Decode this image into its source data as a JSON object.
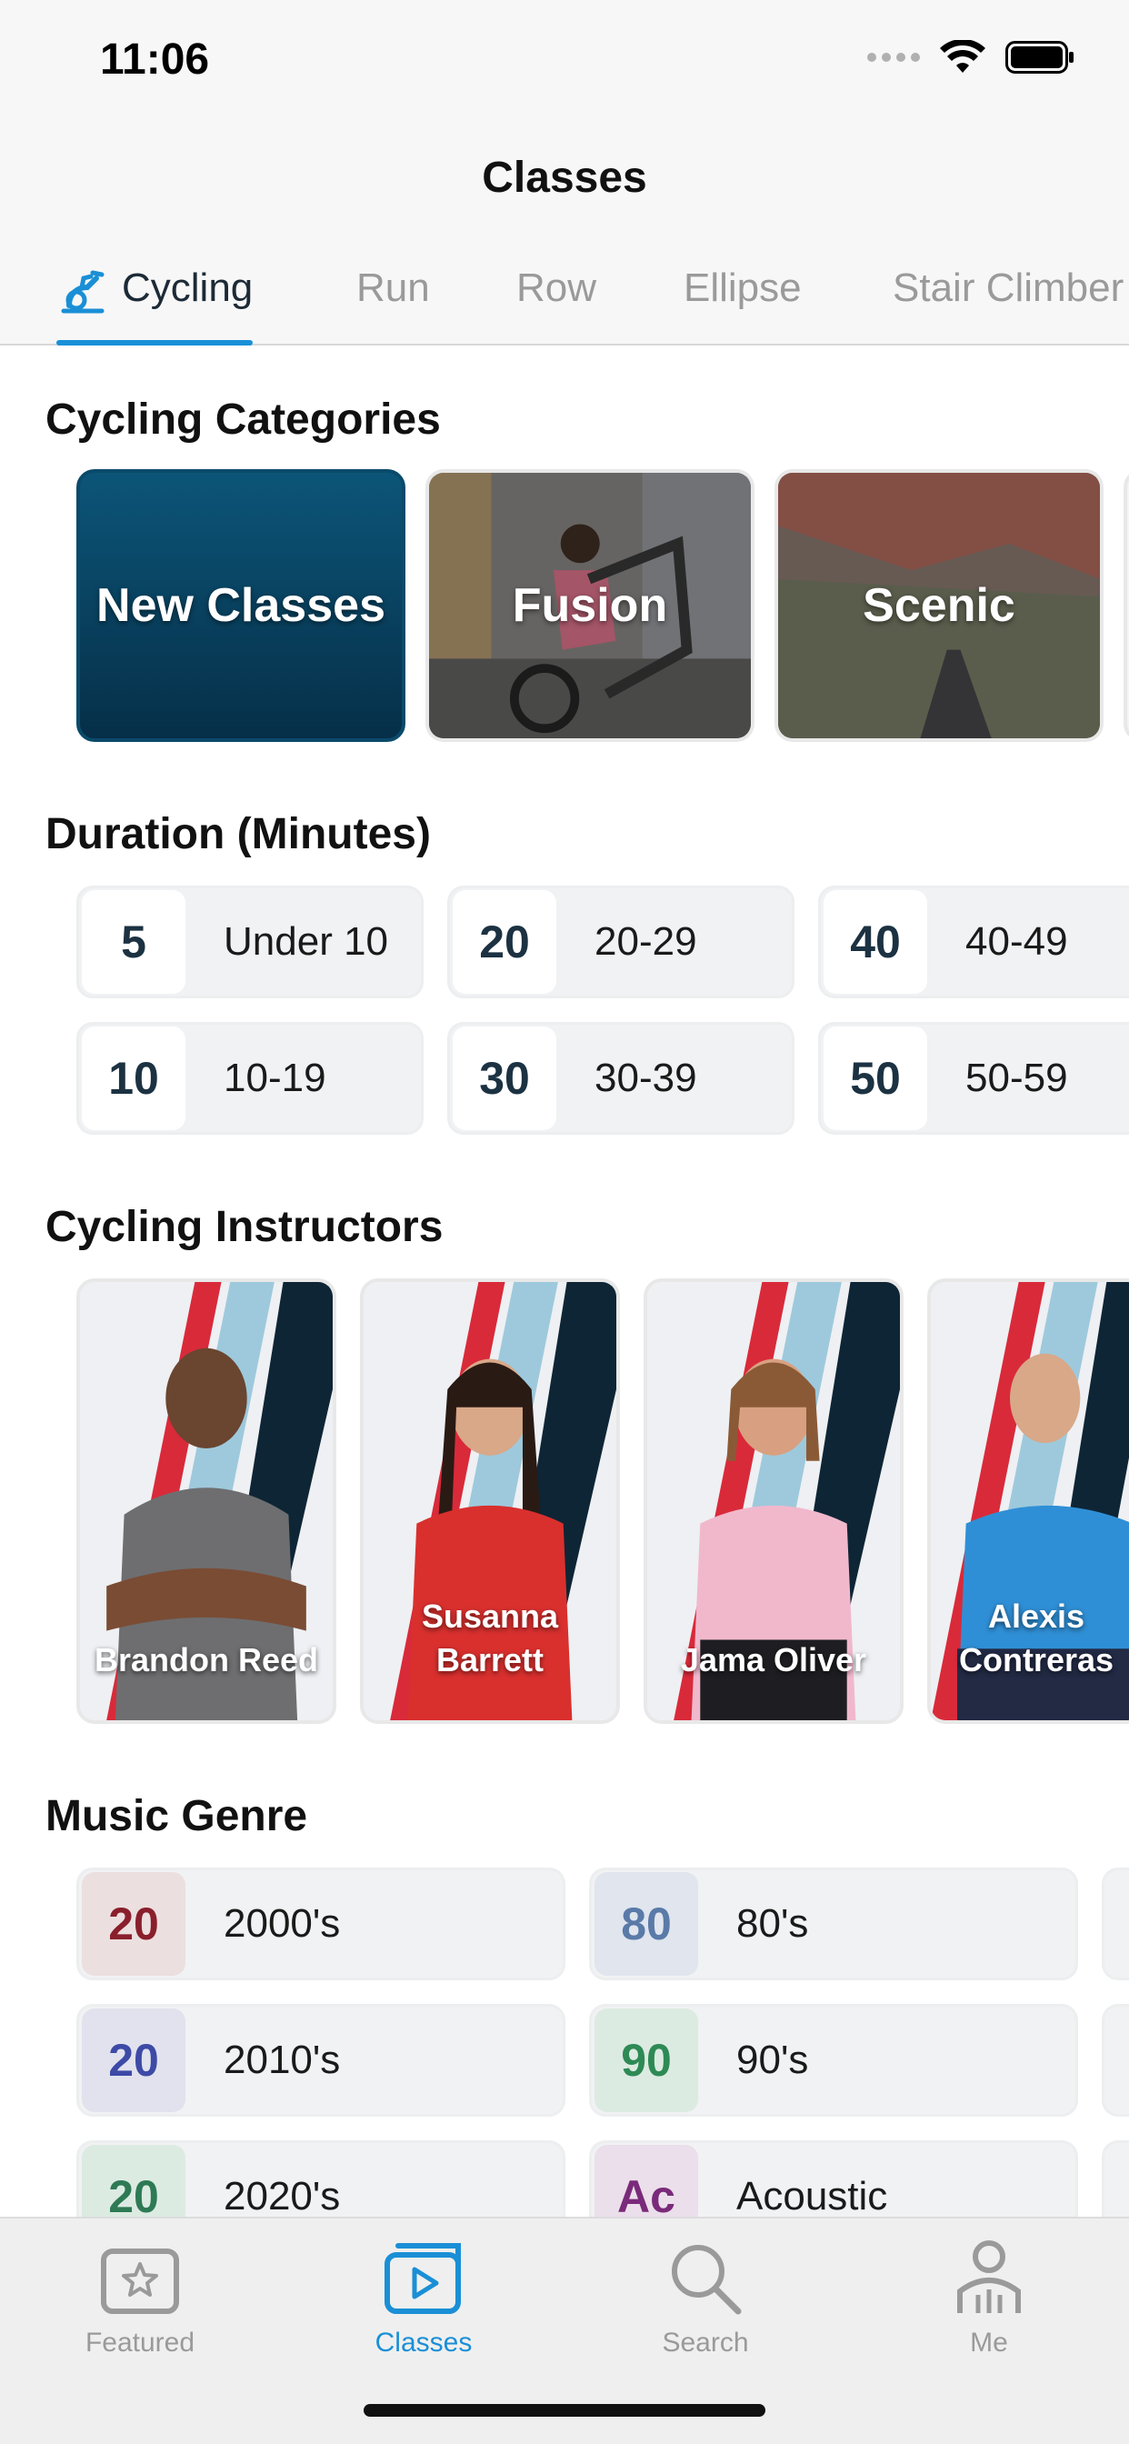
{
  "status_bar": {
    "time": "11:06"
  },
  "header": {
    "title": "Classes"
  },
  "tabs": [
    {
      "label": "Cycling",
      "active": true
    },
    {
      "label": "Run",
      "active": false
    },
    {
      "label": "Row",
      "active": false
    },
    {
      "label": "Ellipse",
      "active": false
    },
    {
      "label": "Stair Climber",
      "active": false
    }
  ],
  "categories": {
    "title": "Cycling Categories",
    "items": [
      {
        "label": "New Classes"
      },
      {
        "label": "Fusion"
      },
      {
        "label": "Scenic"
      }
    ]
  },
  "duration": {
    "title": "Duration (Minutes)",
    "items": [
      {
        "num": "5",
        "label": "Under 10"
      },
      {
        "num": "20",
        "label": "20-29"
      },
      {
        "num": "40",
        "label": "40-49"
      },
      {
        "num": "10",
        "label": "10-19"
      },
      {
        "num": "30",
        "label": "30-39"
      },
      {
        "num": "50",
        "label": "50-59"
      }
    ]
  },
  "instructors": {
    "title": "Cycling Instructors",
    "items": [
      {
        "name": "Brandon Reed"
      },
      {
        "name": "Susanna\nBarrett"
      },
      {
        "name": "Jama Oliver"
      },
      {
        "name": "Alexis\nContreras"
      }
    ]
  },
  "music": {
    "title": "Music Genre",
    "items": [
      {
        "num": "20",
        "label": "2000's",
        "color": "#8a1f2c",
        "bg": "#ecdfe0"
      },
      {
        "num": "80",
        "label": "80's",
        "color": "#5a7aa8",
        "bg": "#e0e5ee"
      },
      {
        "num": "20",
        "label": "2010's",
        "color": "#3d4aa6",
        "bg": "#e1e2ee"
      },
      {
        "num": "90",
        "label": "90's",
        "color": "#2e8a55",
        "bg": "#dcebe2"
      },
      {
        "num": "20",
        "label": "2020's",
        "color": "#2e7a55",
        "bg": "#dcebe2"
      },
      {
        "num": "Ac",
        "label": "Acoustic",
        "color": "#7a2a7a",
        "bg": "#ebdfeb"
      }
    ]
  },
  "tab_bar": {
    "items": [
      {
        "label": "Featured",
        "active": false
      },
      {
        "label": "Classes",
        "active": true
      },
      {
        "label": "Search",
        "active": false
      },
      {
        "label": "Me",
        "active": false
      }
    ]
  },
  "colors": {
    "accent": "#1a8fd6",
    "dark_navy": "#0d3a55"
  }
}
